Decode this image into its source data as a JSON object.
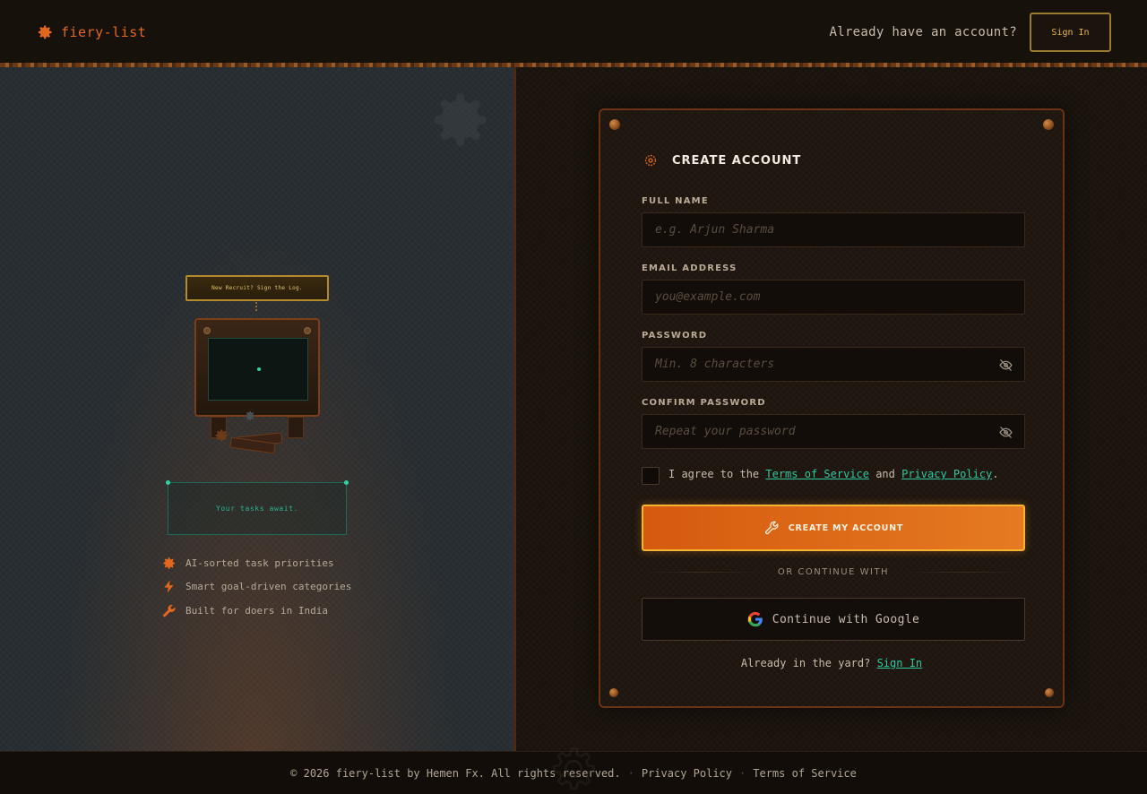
{
  "header": {
    "brand_name": "fiery-list",
    "prompt": "Already have an account?",
    "signin_label": "Sign In"
  },
  "illustration": {
    "sign_text": "New Recruit? Sign the Log.",
    "terminal_text": "Your tasks await."
  },
  "features": [
    {
      "icon": "gear-icon",
      "label": "AI-sorted task priorities"
    },
    {
      "icon": "lightning-icon",
      "label": "Smart goal-driven categories"
    },
    {
      "icon": "wrench-icon",
      "label": "Built for doers in India"
    }
  ],
  "form": {
    "title": "CREATE ACCOUNT",
    "full_name": {
      "label": "FULL NAME",
      "placeholder": "e.g. Arjun Sharma",
      "value": ""
    },
    "email": {
      "label": "EMAIL ADDRESS",
      "placeholder": "you@example.com",
      "value": ""
    },
    "password": {
      "label": "PASSWORD",
      "placeholder": "Min. 8 characters",
      "value": ""
    },
    "confirm": {
      "label": "CONFIRM PASSWORD",
      "placeholder": "Repeat your password",
      "value": ""
    },
    "agree": {
      "prefix": "I agree to the ",
      "terms": "Terms of Service",
      "middle": " and ",
      "privacy": "Privacy Policy",
      "suffix": "."
    },
    "submit_label": "CREATE MY ACCOUNT",
    "divider_text": "OR CONTINUE WITH",
    "google_label": "Continue with Google",
    "signin_prompt": "Already in the yard?",
    "signin_link": "Sign In"
  },
  "footer": {
    "copyright": "© 2026 fiery-list by Hemen Fx. All rights reserved.",
    "sep": "·",
    "privacy": "Privacy Policy",
    "terms": "Terms of Service"
  },
  "colors": {
    "accent": "#e3681c",
    "link": "#2fc9a2",
    "button": "#d55a0e",
    "button_border": "#f5b332"
  }
}
